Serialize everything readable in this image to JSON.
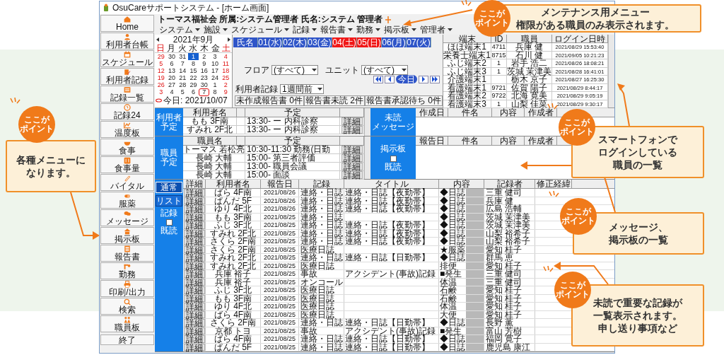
{
  "window": {
    "title": "OsuCareサポートシステム - [ホーム画面]"
  },
  "header": {
    "org_info": "トーマス福祉会 所属:システム管理者 氏名:システム 管理者"
  },
  "sidebar": {
    "items": [
      {
        "label": "Home"
      },
      {
        "label": "利用者台帳"
      },
      {
        "label": "スケジュール"
      },
      {
        "label": "利用者記録"
      },
      {
        "label": "記録一覧"
      },
      {
        "label": "記録24"
      },
      {
        "label": "温度板"
      },
      {
        "label": "食事"
      },
      {
        "label": "食事量"
      },
      {
        "label": "バイタル"
      },
      {
        "label": "服薬"
      },
      {
        "label": "メッセージ"
      },
      {
        "label": "掲示板"
      },
      {
        "label": "報告書"
      },
      {
        "label": "勤務"
      },
      {
        "label": "印刷/出力"
      },
      {
        "label": "検索"
      },
      {
        "label": "職員板"
      }
    ],
    "exit_button": "終了"
  },
  "menu": [
    {
      "label": "システム"
    },
    {
      "label": "施設"
    },
    {
      "label": "スケジュール"
    },
    {
      "label": "記録"
    },
    {
      "label": "報告書"
    },
    {
      "label": "勤務"
    },
    {
      "label": "掲示板"
    },
    {
      "label": "管理者"
    }
  ],
  "calendar": {
    "month": "2021年9月",
    "weekdays": [
      "日",
      "月",
      "火",
      "水",
      "木",
      "金",
      "土"
    ],
    "weeks": [
      [
        {
          "day": "29",
          "selected": false,
          "today": false
        },
        {
          "day": "30",
          "selected": false,
          "today": false
        },
        {
          "day": "31",
          "selected": false,
          "today": false
        },
        {
          "day": "1",
          "selected": true,
          "today": false
        },
        {
          "day": "2",
          "selected": false,
          "today": false
        },
        {
          "day": "3",
          "selected": false,
          "today": false
        },
        {
          "day": "4",
          "selected": false,
          "today": false
        }
      ],
      [
        {
          "day": "5",
          "selected": false,
          "today": false
        },
        {
          "day": "6",
          "selected": false,
          "today": false
        },
        {
          "day": "7",
          "selected": false,
          "today": false
        },
        {
          "day": "8",
          "selected": false,
          "today": false
        },
        {
          "day": "9",
          "selected": false,
          "today": false
        },
        {
          "day": "10",
          "selected": false,
          "today": false
        },
        {
          "day": "11",
          "selected": false,
          "today": false
        }
      ],
      [
        {
          "day": "12",
          "selected": false,
          "today": false
        },
        {
          "day": "13",
          "selected": false,
          "today": false
        },
        {
          "day": "14",
          "selected": false,
          "today": false
        },
        {
          "day": "15",
          "selected": false,
          "today": false
        },
        {
          "day": "16",
          "selected": false,
          "today": false
        },
        {
          "day": "17",
          "selected": false,
          "today": false
        },
        {
          "day": "18",
          "selected": false,
          "today": false
        }
      ],
      [
        {
          "day": "19",
          "selected": false,
          "today": false
        },
        {
          "day": "20",
          "selected": false,
          "today": false
        },
        {
          "day": "21",
          "selected": false,
          "today": false
        },
        {
          "day": "22",
          "selected": false,
          "today": false
        },
        {
          "day": "23",
          "selected": false,
          "today": false
        },
        {
          "day": "24",
          "selected": false,
          "today": false
        },
        {
          "day": "25",
          "selected": false,
          "today": false
        }
      ],
      [
        {
          "day": "26",
          "selected": false,
          "today": false
        },
        {
          "day": "27",
          "selected": false,
          "today": false
        },
        {
          "day": "28",
          "selected": false,
          "today": false
        },
        {
          "day": "29",
          "selected": false,
          "today": false
        },
        {
          "day": "30",
          "selected": false,
          "today": false
        },
        {
          "day": "1",
          "selected": false,
          "today": false
        },
        {
          "day": "2",
          "selected": false,
          "today": false
        }
      ],
      [
        {
          "day": "3",
          "selected": false,
          "today": false
        },
        {
          "day": "4",
          "selected": false,
          "today": false
        },
        {
          "day": "5",
          "selected": false,
          "today": false
        },
        {
          "day": "6",
          "selected": false,
          "today": false
        },
        {
          "day": "7",
          "selected": false,
          "today": true
        },
        {
          "day": "8",
          "selected": false,
          "today": false
        },
        {
          "day": "9",
          "selected": false,
          "today": false
        }
      ]
    ],
    "today": "今日: 2021/10/07"
  },
  "schedule": {
    "columns": [
      {
        "label": "氏名",
        "holiday": false
      },
      {
        "label": "01(水)",
        "holiday": false
      },
      {
        "label": "02(木)",
        "holiday": false
      },
      {
        "label": "03(金)",
        "holiday": false
      },
      {
        "label": "04(土)",
        "holiday": true
      },
      {
        "label": "05(日)",
        "holiday": true
      },
      {
        "label": "06(月)",
        "holiday": false
      },
      {
        "label": "07(火)",
        "holiday": false
      }
    ]
  },
  "filters": [
    {
      "label": "フロア",
      "value": "(すべて)"
    },
    {
      "label": "ユニット",
      "value": "(すべて)"
    },
    {
      "label": "利用者記録",
      "value": "1週間前"
    }
  ],
  "nav": {
    "today_button": "今日"
  },
  "report_buttons": [
    "未作成報告書 0件",
    "報告書未読 2件",
    "報告書承認待ち 0件"
  ],
  "device_logins": {
    "columns": [
      "端末",
      "ID",
      "職員",
      "ログイン日時"
    ],
    "rows": [
      [
        "ほほ端末1",
        "4711",
        "兵庫 健",
        "2021/08/29 15:53:40"
      ],
      [
        "栄養士端末1",
        "8715",
        "石川 健",
        "2021/09/05 10:21:23"
      ],
      [
        "ふじ端末2",
        "1",
        "岩手 浩二",
        "2021/08/26 18:08:21"
      ],
      [
        "ふじ端末3",
        "1",
        "茨城 茉津美",
        "2021/08/28 16:41:01"
      ],
      [
        "介護端末1",
        "",
        "栃木 京子",
        "2021/08/27 16:25:30"
      ],
      [
        "看護端末1",
        "9721",
        "佐賀 陽子",
        "2021/08/29 8:44:17"
      ],
      [
        "看護端末2",
        "9722",
        "北海 寛美",
        "2021/08/29 9:05:19"
      ],
      [
        "看護端末3",
        "1",
        "山梨 佳菜",
        "2021/08/29 9:30:17"
      ]
    ]
  },
  "resident_schedule": {
    "label": [
      "利用者",
      "予定"
    ],
    "columns": [
      "利用者名",
      "予定"
    ],
    "rows": [
      {
        "name": "もも 3F南",
        "plan": "13:30- ー 内科診察",
        "detail_button": "詳細"
      },
      {
        "name": "すみれ 2F北",
        "plan": "13:30- ー 内科診察",
        "detail_button": "詳細"
      }
    ]
  },
  "unread_messages": {
    "label": [
      "未読",
      "メッセージ"
    ],
    "columns": [
      "作成日",
      "件名",
      "内容",
      "作成者"
    ]
  },
  "staff_schedule": {
    "label": [
      "職員",
      "予定"
    ],
    "columns": [
      "職員名",
      "予定"
    ],
    "rows": [
      {
        "name": "トーマス 若松亮",
        "plan": "10:30-11:30 勤務(日勤",
        "detail_button": "詳細"
      },
      {
        "name": "長崎 大輔",
        "plan": "15:00- 第三者評価",
        "detail_button": "詳細"
      },
      {
        "name": "長崎 大輔",
        "plan": "13:00- 職員会議",
        "detail_button": "詳細"
      },
      {
        "name": "長崎 大輔",
        "plan": "15:00- 面談",
        "detail_button": "詳細"
      }
    ]
  },
  "bulletin_board": {
    "label": "掲示板",
    "read_checkbox": {
      "label": "既読",
      "checked": false
    },
    "columns": [
      "報告日",
      "件名",
      "内容",
      "作成者"
    ]
  },
  "records": {
    "view_tabs": [
      {
        "label": "通常",
        "selected": true
      },
      {
        "label": "リスト",
        "selected": false
      }
    ],
    "section_label": "記録",
    "read_checkbox": {
      "label": "既読",
      "checked": false
    },
    "columns": [
      "詳細",
      "利用者名",
      "報告日",
      "記録",
      "タイトル",
      "内容",
      "記録者",
      "修正経緯"
    ],
    "rows": [
      {
        "detail": "詳細",
        "resident": "ばら 4F南",
        "date": "2021/08/26",
        "record": "連絡・日誌",
        "title": "連絡・日誌【夜勤帯】",
        "content": "◆日誌",
        "recorder": "三重 健司"
      },
      {
        "detail": "詳細",
        "resident": "ぱんだ 5F",
        "date": "2021/08/26",
        "record": "連絡・日誌",
        "title": "連絡・日誌【夜勤帯】",
        "content": "◆日誌",
        "recorder": "兵庫 健"
      },
      {
        "detail": "詳細",
        "resident": "ゆり 4F北",
        "date": "2021/08/26",
        "record": "連絡・日誌",
        "title": "連絡・日誌【夜勤帯】",
        "content": "◆日誌",
        "recorder": "広島 浩輔"
      },
      {
        "detail": "詳細",
        "resident": "もも 3F南",
        "date": "2021/08/25",
        "record": "連絡・日誌",
        "content": "◆日誌",
        "recorder": "茨城 茉津美"
      },
      {
        "detail": "詳細",
        "resident": "ふじ 3F北",
        "date": "2021/08/25",
        "record": "連絡・日誌",
        "title": "連絡・日誌【夜勤帯】",
        "content": "◆日誌",
        "recorder": "茨城 茉津美"
      },
      {
        "detail": "詳細",
        "resident": "すみれ 2F北",
        "date": "2021/08/25",
        "record": "連絡・日誌",
        "title": "連絡・日誌【夜勤帯】",
        "content": "◆日誌",
        "recorder": "山梨 裕希子"
      },
      {
        "detail": "詳細",
        "resident": "さくら 2F南",
        "date": "2021/08/25",
        "record": "連絡・日誌",
        "title": "連絡・日誌【夜勤帯】",
        "content": "◆日誌",
        "recorder": "山梨 裕希子"
      },
      {
        "detail": "詳細",
        "resident": "さくら 2F南",
        "date": "2021/08/25",
        "record": "医療日誌",
        "content": "★服薬",
        "recorder": "愛知 桂子"
      },
      {
        "detail": "詳細",
        "resident": "すみれ 2F北",
        "date": "2021/08/25",
        "record": "連絡・日誌",
        "title": "連絡・日誌【日勤帯】",
        "content": "◆日誌",
        "recorder": "群馬 恵"
      },
      {
        "detail": "詳細",
        "resident": "すみれ 2F北",
        "date": "2021/08/25",
        "record": "医療日誌",
        "content": "排便",
        "recorder": "愛知 桂子"
      },
      {
        "detail": "詳細",
        "resident": "兵庫 裕子",
        "date": "2021/08/25",
        "record": "事故",
        "title": "アクシデント(事故)記録",
        "content": "■発生",
        "recorder": "三重 健司"
      },
      {
        "detail": "詳細",
        "resident": "兵庫 裕子",
        "date": "2021/08/25",
        "record": "オンコール",
        "content": "体温",
        "recorder": "三重 健司"
      },
      {
        "detail": "詳細",
        "resident": "ふじ 3F北",
        "date": "2021/08/25",
        "record": "医療日誌",
        "content": "石鹸",
        "recorder": "愛知 桂子"
      },
      {
        "detail": "詳細",
        "resident": "もも 3F南",
        "date": "2021/08/25",
        "record": "医療日誌",
        "content": "石鹸",
        "recorder": "愛知 桂子"
      },
      {
        "detail": "詳細",
        "resident": "ゆり 4F北",
        "date": "2021/08/25",
        "record": "医療日誌",
        "content": "体温",
        "recorder": "愛知 桂子"
      },
      {
        "detail": "詳細",
        "resident": "ばら 4F南",
        "date": "2021/08/25",
        "record": "医療日誌",
        "content": "大便",
        "recorder": "愛知 桂子"
      },
      {
        "detail": "詳細",
        "resident": "さくら 2F南",
        "date": "2021/08/25",
        "record": "連絡・日誌",
        "title": "連絡・日誌【日勤帯】",
        "content": "◆日誌",
        "recorder": "長野 薫"
      },
      {
        "detail": "詳細",
        "resident": "京都 トヨ",
        "date": "2021/08/25",
        "record": "事故",
        "title": "アクシデント(事故)記録",
        "content": "■発生",
        "recorder": "富山 芳樹"
      },
      {
        "detail": "詳細",
        "resident": "ばら 4F南",
        "date": "2021/08/25",
        "record": "連絡・日誌",
        "title": "連絡・日誌【日勤帯】",
        "content": "◆日誌",
        "recorder": "福岡 寛子"
      },
      {
        "detail": "詳細",
        "resident": "ぱんだ 5F",
        "date": "2021/08/25",
        "record": "連絡・日誌",
        "title": "連絡・日誌【日勤帯】",
        "content": "◆日誌",
        "recorder": "鹿児島 康江"
      }
    ]
  },
  "callouts": [
    {
      "badge": [
        "ここが",
        "ポイント"
      ],
      "lines": [
        "メンテナンス用メニュー",
        "権限がある職員のみ表示されます。"
      ]
    },
    {
      "badge": [
        "ここが",
        "ポイント"
      ],
      "lines": [
        "スマートフォンで",
        "ログインしている",
        "職員の一覧"
      ]
    },
    {
      "badge": [
        "ここが",
        "ポイント"
      ],
      "lines": [
        "メッセージ、",
        "掲示板の一覧"
      ]
    },
    {
      "badge": [
        "ここが",
        "ポイント"
      ],
      "lines": [
        "未読で重要な記録が",
        "一覧表示されます。",
        "申し送り事項など"
      ]
    },
    {
      "badge": [
        "ここが",
        "ポイント"
      ],
      "lines": [
        "各種メニューに",
        "なります。"
      ]
    }
  ]
}
